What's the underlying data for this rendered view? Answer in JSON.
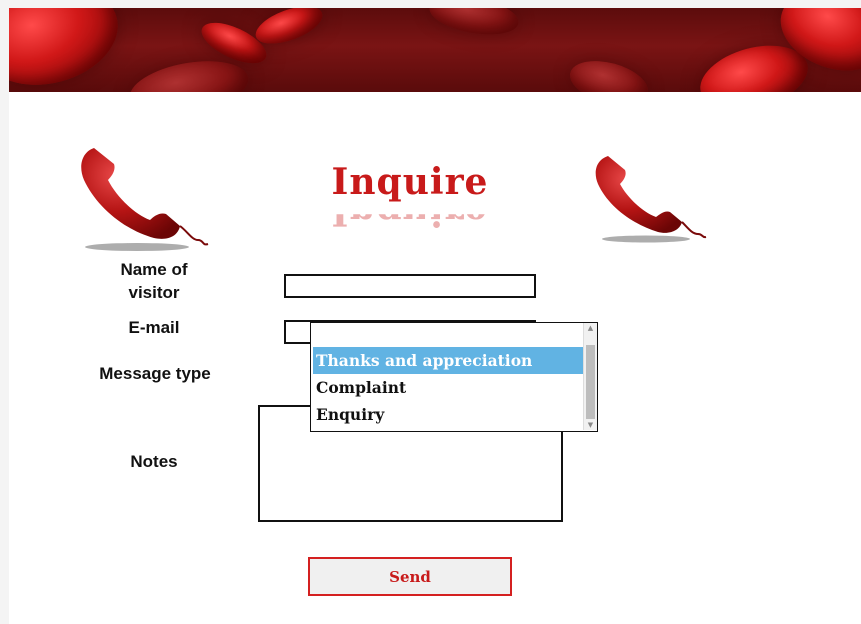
{
  "header": {
    "banner_image": "blood-cells-banner"
  },
  "title": {
    "text": "Inquire"
  },
  "icons": {
    "left": "telephone-icon",
    "right": "telephone-icon"
  },
  "colors": {
    "accent": "#c81a1a",
    "selected_option": "#61b3e3",
    "button_border": "#d42020"
  },
  "form": {
    "name_label": "Name of visitor",
    "name_label_line1": "Name of",
    "name_label_line2": "visitor",
    "name_value": "",
    "email_label": "E-mail",
    "email_value": "",
    "message_type_label": "Message type",
    "message_type_options": [
      {
        "label": "Thanks and appreciation",
        "selected": true
      },
      {
        "label": "Complaint",
        "selected": false
      },
      {
        "label": "Enquiry",
        "selected": false
      }
    ],
    "notes_label": "Notes",
    "notes_value": "",
    "send_label": "Send"
  }
}
